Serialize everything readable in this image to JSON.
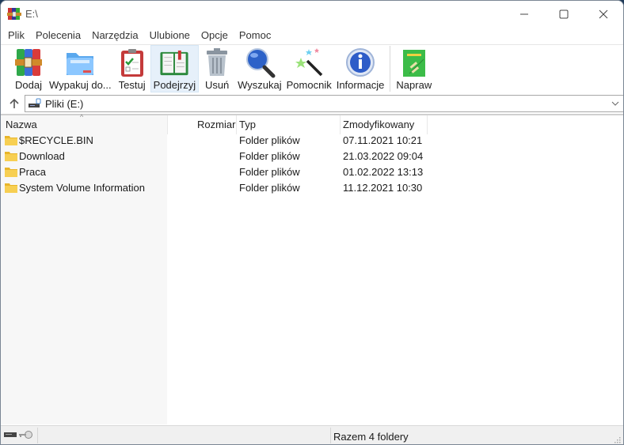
{
  "window": {
    "title": "E:\\",
    "app_icon": "winrar-icon",
    "controls": {
      "minimize": "minimize-icon",
      "maximize": "maximize-icon",
      "close": "close-icon"
    }
  },
  "menu": {
    "items": [
      {
        "label": "Plik"
      },
      {
        "label": "Polecenia"
      },
      {
        "label": "Narzędzia"
      },
      {
        "label": "Ulubione"
      },
      {
        "label": "Opcje"
      },
      {
        "label": "Pomoc"
      }
    ]
  },
  "toolbar": {
    "buttons": [
      {
        "label": "Dodaj",
        "icon": "add-archive-icon",
        "active": false
      },
      {
        "label": "Wypakuj do...",
        "icon": "extract-folder-icon",
        "active": false
      },
      {
        "label": "Testuj",
        "icon": "test-clipboard-icon",
        "active": false
      },
      {
        "label": "Podejrzyj",
        "icon": "view-book-icon",
        "active": true
      },
      {
        "label": "Usuń",
        "icon": "trash-icon",
        "active": false
      },
      {
        "label": "Wyszukaj",
        "icon": "search-icon",
        "active": false
      },
      {
        "label": "Pomocnik",
        "icon": "wizard-wand-icon",
        "active": false
      },
      {
        "label": "Informacje",
        "icon": "info-icon",
        "active": false
      },
      {
        "label": "Napraw",
        "icon": "repair-icon",
        "active": false
      }
    ]
  },
  "address": {
    "up_icon": "up-arrow-icon",
    "drive_icon": "drive-icon",
    "path": "Pliki (E:)",
    "dropdown_icon": "chevron-down-icon"
  },
  "list": {
    "columns": [
      {
        "label": "Nazwa",
        "sorted": "ascending"
      },
      {
        "label": "Rozmiar"
      },
      {
        "label": "Typ"
      },
      {
        "label": "Zmodyfikowany"
      }
    ],
    "rows": [
      {
        "name": "$RECYCLE.BIN",
        "size": "",
        "type": "Folder plików",
        "modified": "07.11.2021 10:21"
      },
      {
        "name": "Download",
        "size": "",
        "type": "Folder plików",
        "modified": "21.03.2022 09:04"
      },
      {
        "name": "Praca",
        "size": "",
        "type": "Folder plików",
        "modified": "01.02.2022 13:13"
      },
      {
        "name": "System Volume Information",
        "size": "",
        "type": "Folder plików",
        "modified": "11.12.2021 10:30"
      }
    ]
  },
  "status": {
    "text": "Razem 4 foldery",
    "icons": [
      "drive-status-icon",
      "key-icon"
    ]
  },
  "colors": {
    "active_button_bg": "#e6f0fa",
    "name_column_bg": "#f7f7f7",
    "folder": "#f5c542"
  }
}
